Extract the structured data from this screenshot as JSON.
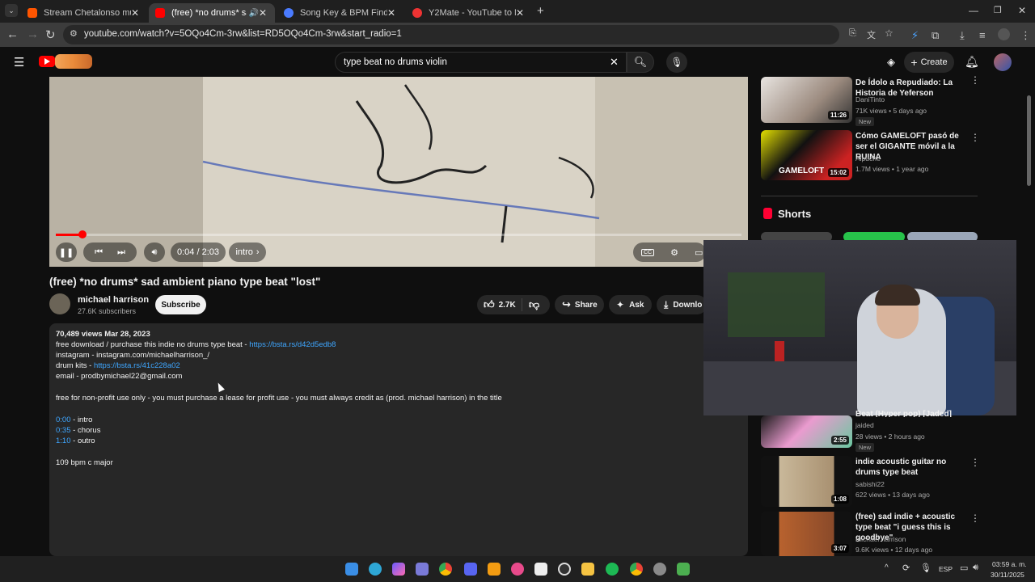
{
  "browser": {
    "tabs": [
      {
        "title": "Stream Chetalonso music | Liste",
        "active": false,
        "favicon_color": "#ff5500"
      },
      {
        "title": "(free) *no drums* sad ambi",
        "active": true,
        "favicon_color": "#ff0000"
      },
      {
        "title": "Song Key & BPM Finder | Tune",
        "active": false,
        "favicon_color": "#4a7bff"
      },
      {
        "title": "Y2Mate - YouTube to MP3 Conv",
        "active": false,
        "favicon_color": "#e33"
      }
    ],
    "url": "youtube.com/watch?v=5OQo4Cm-3rw&list=RD5OQo4Cm-3rw&start_radio=1"
  },
  "header": {
    "search_value": "type beat no drums violin",
    "create_label": "Create"
  },
  "player": {
    "time": "0:04 / 2:03",
    "chapter": "intro",
    "progress": 0.039
  },
  "video": {
    "title": "(free) *no drums* sad ambient piano type beat \"lost\"",
    "channel": "michael harrison",
    "subscribers": "27.6K subscribers",
    "subscribe_label": "Subscribe",
    "likes": "2.7K",
    "share_label": "Share",
    "ask_label": "Ask",
    "download_label": "Downlo"
  },
  "description": {
    "views_date": "70,489 views  Mar 28, 2023",
    "line1_text": "free download / purchase this indie no drums type beat - ",
    "line1_link": "https://bsta.rs/d42d5edb8",
    "line2": "instagram - instagram.com/michaelharrison_/",
    "line3_text": "drum kits - ",
    "line3_link": "https://bsta.rs/41c228a02",
    "line4": "email - prodbymichael22@gmail.com",
    "line5": "free for non-profit use only - you must purchase a lease for profit use - you must always credit as (prod. michael harrison) in the title",
    "chapters": [
      {
        "time": "0:00",
        "label": " - intro"
      },
      {
        "time": "0:35",
        "label": " - chorus"
      },
      {
        "time": "1:10",
        "label": " - outro"
      }
    ],
    "bpm_key": "109 bpm c major"
  },
  "sidebar": {
    "videos_top": [
      {
        "title": "De Ídolo a Repudiado: La Historia de Yeferson Soteldo",
        "channel": "DaniTinto",
        "meta": "71K views • 5 days ago",
        "badge": "New",
        "duration": "11:26"
      },
      {
        "title": "Cómo GAMELOFT pasó de ser el GIGANTE móvil a la RUINA",
        "channel": "Alpuche",
        "meta": "1.7M views • 1 year ago",
        "duration": "15:02",
        "thumb_text": "GAMELOFT"
      }
    ],
    "shorts_label": "Shorts",
    "videos_bottom": [
      {
        "title": "Beat (Hyper pop) [Jaded]",
        "channel": "jaided",
        "meta": "28 views • 2 hours ago",
        "badge": "New",
        "duration": "2:55"
      },
      {
        "title": "indie acoustic guitar no drums type beat",
        "channel": "sabishi22",
        "meta": "622 views • 13 days ago",
        "duration": "1:08"
      },
      {
        "title": "(free) sad indie + acoustic type beat \"i guess this is goodbye\"",
        "channel": "michael harrison",
        "meta": "9.6K views • 12 days ago",
        "duration": "3:07"
      }
    ]
  },
  "taskbar": {
    "lang": "ESP",
    "time": "03:59 a. m.",
    "date": "30/11/2025"
  }
}
